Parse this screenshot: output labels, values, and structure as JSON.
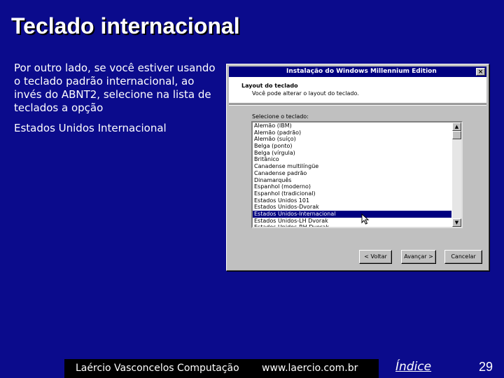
{
  "slide": {
    "title": "Teclado internacional",
    "paragraph1": "Por outro lado, se você estiver usando o teclado padrão internacional, ao invés do ABNT2, selecione na lista de teclados a opção",
    "paragraph2": "Estados Unidos Internacional"
  },
  "dialog": {
    "title": "Instalação do Windows Millennium Edition",
    "close_symbol": "×",
    "header_title": "Layout do teclado",
    "header_subtitle": "Você pode alterar o layout do teclado.",
    "list_label": "Selecione o teclado:",
    "list_items": [
      "Alemão (IBM)",
      "Alemão (padrão)",
      "Alemão (suíço)",
      "Belga (ponto)",
      "Belga (vírgula)",
      "Britânico",
      "Canadense multilíngüe",
      "Canadense padrão",
      "Dinamarquês",
      "Espanhol (moderno)",
      "Espanhol (tradicional)",
      "Estados Unidos 101",
      "Estados Unidos-Dvorak",
      "Estados Unidos-Internacional",
      "Estados Unidos-LH Dvorak",
      "Estados Unidos-RH Dvorak"
    ],
    "selected_item": "Estados Unidos-Internacional",
    "scroll_up_symbol": "▲",
    "scroll_down_symbol": "▼",
    "buttons": {
      "back": "< Voltar",
      "next": "Avançar >",
      "cancel": "Cancelar"
    }
  },
  "footer": {
    "company": "Laércio Vasconcelos Computação",
    "website": "www.laercio.com.br",
    "index_link": "Índice",
    "page_number": "29"
  },
  "colors": {
    "slide_background": "#0b0b8c",
    "titlebar": "#000080",
    "selection": "#000080",
    "dialog_face": "#c0c0c0"
  }
}
